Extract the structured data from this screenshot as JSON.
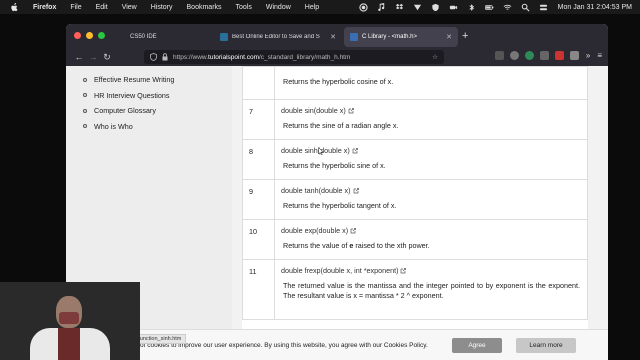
{
  "menubar": {
    "app": "Firefox",
    "items": [
      "File",
      "Edit",
      "View",
      "History",
      "Bookmarks",
      "Tools",
      "Window",
      "Help"
    ],
    "clock": "Mon Jan 31  2:04:53 PM"
  },
  "tabs": [
    {
      "label": "CS50 IDE",
      "active": false
    },
    {
      "label": "Best Online Editor to Save and S",
      "active": false
    },
    {
      "label": "C Library - <math.h>",
      "active": true
    }
  ],
  "url": {
    "prefix": "https://www.",
    "host": "tutorialspoint.com",
    "path": "/c_standard_library/math_h.htm"
  },
  "sidebar": {
    "items": [
      "Effective Resume Writing",
      "HR Interview Questions",
      "Computer Glossary",
      "Who is Who"
    ]
  },
  "functions": [
    {
      "num": "",
      "sig": "",
      "desc": "Returns the hyperbolic cosine of x."
    },
    {
      "num": "7",
      "sig": "double sin(double x)",
      "desc": "Returns the sine of a radian angle x."
    },
    {
      "num": "8",
      "sig": "double sinh(double x)",
      "desc": "Returns the hyperbolic sine of x."
    },
    {
      "num": "9",
      "sig": "double tanh(double x)",
      "desc": "Returns the hyperbolic tangent of x."
    },
    {
      "num": "10",
      "sig": "double exp(double x)",
      "desc_pre": "Returns the value of ",
      "desc_bold": "e",
      "desc_post": " raised to the xth power."
    },
    {
      "num": "11",
      "sig": "double frexp(double x, int *exponent)",
      "desc": "The returned value is the mantissa and the integer pointed to by exponent is the exponent. The resultant value is x = mantissa * 2 ^ exponent."
    }
  ],
  "cookie": {
    "text": "of cookies to improve our user experience. By using this website, you agree with our Cookies Policy.",
    "agree": "Agree",
    "learn_more": "Learn more"
  },
  "status_url": "...m/c_standard_library/c_function_sinh.htm",
  "colors": {
    "menubar_bg": "#1a1a1a",
    "tabbar_bg": "#2b2a33",
    "agree_bg": "#8d8d8d"
  }
}
